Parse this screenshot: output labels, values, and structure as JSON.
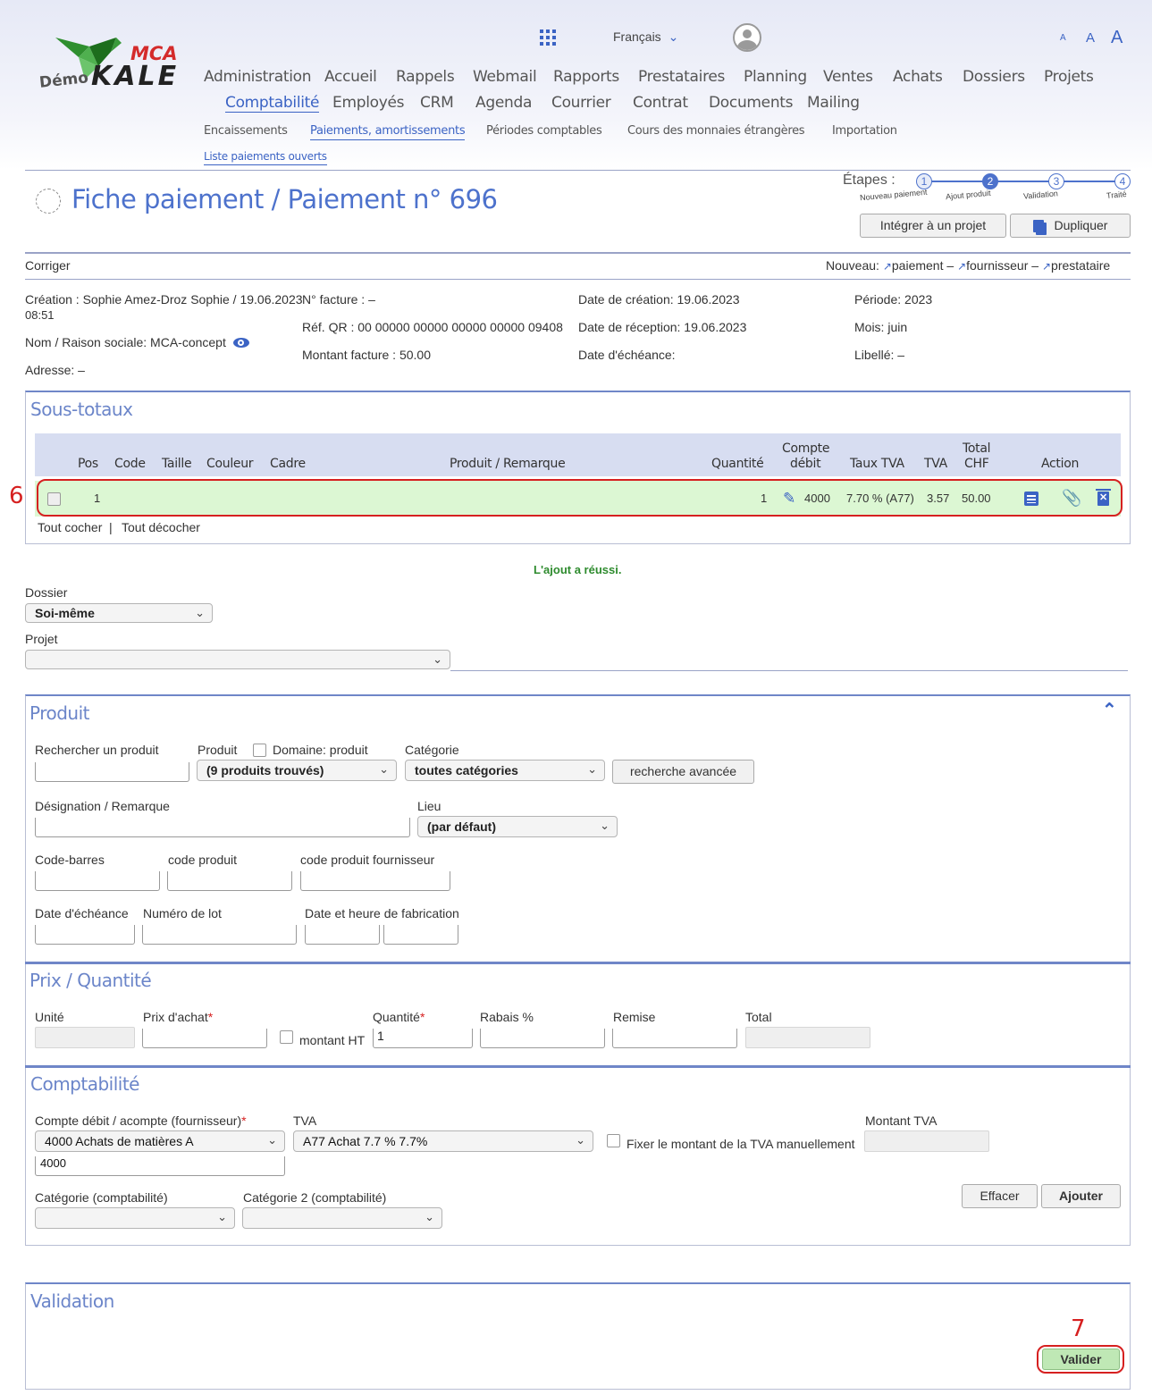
{
  "logo": {
    "demo_text": "Démo",
    "brand_top": "MCA",
    "brand_main": "KALE"
  },
  "header": {
    "language": "Français",
    "font_sizes": [
      "A",
      "A",
      "A"
    ]
  },
  "nav_row1": [
    "Administration",
    "Accueil",
    "Rappels",
    "Webmail",
    "Rapports",
    "Prestataires",
    "Planning",
    "Ventes",
    "Achats",
    "Dossiers",
    "Projets"
  ],
  "nav_row2": [
    "Comptabilité",
    "Employés",
    "CRM",
    "Agenda",
    "Courrier",
    "Contrat",
    "Documents",
    "Mailing"
  ],
  "subnav": [
    "Encaissements",
    "Paiements, amortissements",
    "Périodes comptables",
    "Cours des monnaies étrangères",
    "Importation"
  ],
  "subnav2": "Liste paiements ouverts",
  "title": "Fiche paiement / Paiement n° 696",
  "steps": {
    "label": "Étapes :",
    "items": [
      {
        "num": "1",
        "name": "Nouveau paiement"
      },
      {
        "num": "2",
        "name": "Ajout produit"
      },
      {
        "num": "3",
        "name": "Validation"
      },
      {
        "num": "4",
        "name": "Traité"
      }
    ]
  },
  "buttons": {
    "integrate": "Intégrer à un projet",
    "duplicate": "Dupliquer"
  },
  "bar": {
    "corriger": "Corriger",
    "nouveau": "Nouveau:",
    "paiement": "paiement",
    "fournisseur": "fournisseur",
    "prestataire": "prestataire",
    "sep": "–"
  },
  "info": {
    "creation": "Création : Sophie   Amez-Droz Sophie  /  19.06.2023",
    "creation_time": "08:51",
    "nom": "Nom / Raison sociale: MCA-concept",
    "adresse": "Adresse: –",
    "no_facture": "N° facture : –",
    "ref_qr": "Réf. QR : 00 00000 00000 00000 00000 09408",
    "montant": "Montant facture : 50.00",
    "date_creation": "Date de création: 19.06.2023",
    "date_reception": "Date de réception: 19.06.2023",
    "date_echeance": "Date d'échéance:",
    "periode": "Période: 2023",
    "mois": "Mois: juin",
    "libelle": "Libellé: –"
  },
  "soustotaux": {
    "title": "Sous-totaux",
    "headers": {
      "pos": "Pos",
      "code": "Code",
      "taille": "Taille",
      "couleur": "Couleur",
      "cadre": "Cadre",
      "produit": "Produit / Remarque",
      "quantite": "Quantité",
      "compte1": "Compte",
      "compte2": "débit",
      "taux": "Taux TVA",
      "tva": "TVA",
      "total1": "Total",
      "total2": "CHF",
      "action": "Action"
    },
    "row": {
      "pos": "1",
      "quantite": "1",
      "compte": "4000",
      "taux": "7.70 % (A77)",
      "tva": "3.57",
      "total": "50.00"
    },
    "tout_cocher": "Tout cocher",
    "sep": "|",
    "tout_decocher": "Tout décocher"
  },
  "success": "L'ajout a réussi.",
  "dossier": {
    "label": "Dossier",
    "value": "Soi-même"
  },
  "projet": {
    "label": "Projet",
    "value": ""
  },
  "produit": {
    "title": "Produit",
    "rechercher": "Rechercher un produit",
    "produit_label": "Produit",
    "domaine": "Domaine: produit",
    "produits_value": "(9 produits trouvés)",
    "categorie": "Catégorie",
    "categorie_value": "toutes catégories",
    "recherche_avancee": "recherche avancée",
    "designation": "Désignation / Remarque",
    "lieu": "Lieu",
    "lieu_value": "(par défaut)",
    "code_barres": "Code-barres",
    "code_produit": "code produit",
    "code_fournisseur": "code produit fournisseur",
    "date_echeance": "Date d'échéance",
    "numero_lot": "Numéro de lot",
    "date_fabrication": "Date et heure de fabrication"
  },
  "prix": {
    "title": "Prix / Quantité",
    "unite": "Unité",
    "prix_achat": "Prix d'achat",
    "star": "*",
    "montant_ht": "montant HT",
    "quantite": "Quantité",
    "quantite_value": "1",
    "rabais": "Rabais %",
    "remise": "Remise",
    "total": "Total"
  },
  "compta": {
    "title": "Comptabilité",
    "compte_label": "Compte débit / acompte (fournisseur)",
    "compte_value": "4000   Achats de matières A",
    "compte_input": "4000",
    "tva_label": "TVA",
    "tva_value": "A77   Achat 7.7 %   7.7%",
    "fixer": "Fixer le montant de la TVA manuellement",
    "montant_tva": "Montant TVA",
    "categorie": "Catégorie (comptabilité)",
    "categorie2": "Catégorie 2 (comptabilité)",
    "effacer": "Effacer",
    "ajouter": "Ajouter"
  },
  "validation": {
    "title": "Validation",
    "valider": "Valider"
  },
  "annotations": {
    "six": "6",
    "seven": "7"
  },
  "colors": {
    "accent": "#3b63c4",
    "row_green": "#dcf7d3",
    "annotation_red": "#d62020",
    "success_green": "#2e8b2e"
  }
}
